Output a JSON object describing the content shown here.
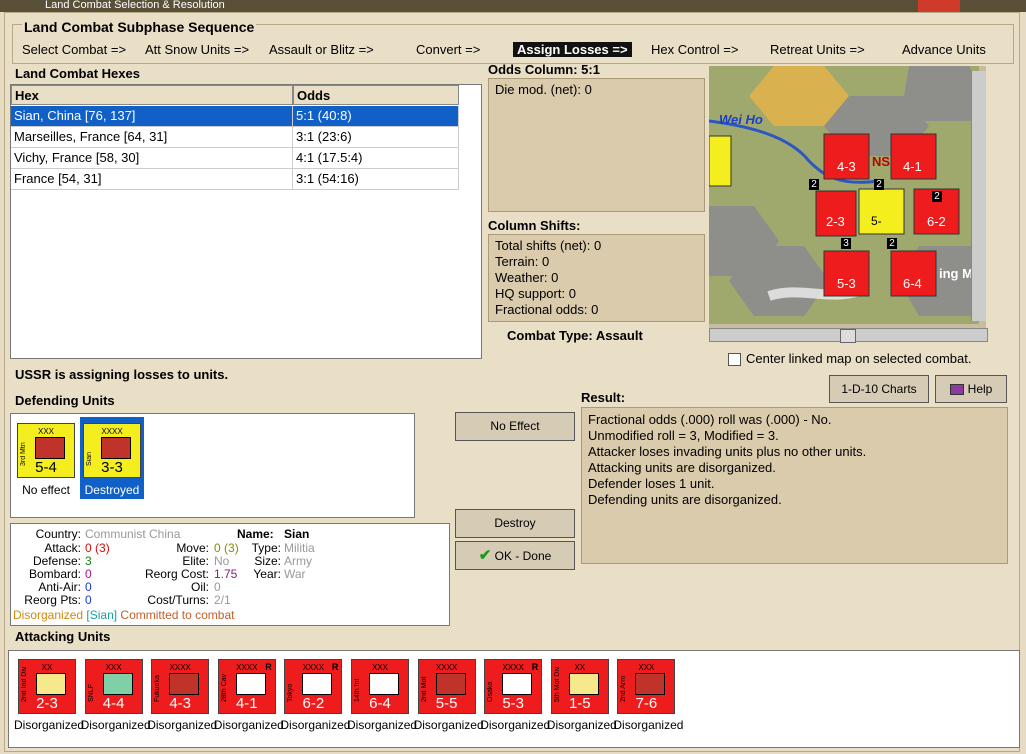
{
  "window": {
    "title": "Land Combat Selection & Resolution"
  },
  "sequence": {
    "title": "Land Combat Subphase Sequence",
    "steps": [
      "Select Combat =>",
      "Att Snow Units =>",
      "Assault or Blitz =>",
      "Convert =>",
      "Assign Losses =>",
      "Hex Control =>",
      "Retreat Units =>",
      "Advance Units"
    ],
    "active_step": "Assign Losses =>"
  },
  "hexes": {
    "title": "Land Combat Hexes",
    "columns": [
      "Hex",
      "Odds"
    ],
    "rows": [
      {
        "hex": "Sian, China [76, 137]",
        "odds": "5:1 (40:8)"
      },
      {
        "hex": "Marseilles, France [64, 31]",
        "odds": "3:1 (23:6)"
      },
      {
        "hex": "Vichy, France [58, 30]",
        "odds": "4:1 (17.5:4)"
      },
      {
        "hex": "France [54, 31]",
        "odds": "3:1 (54:16)"
      }
    ]
  },
  "odds": {
    "title": "Odds Column: 5:1",
    "die_mod": "Die mod. (net): 0"
  },
  "shifts": {
    "title": "Column Shifts:",
    "lines": [
      "Total shifts (net): 0",
      "Terrain: 0",
      "Weather: 0",
      "HQ support: 0",
      "Fractional odds: 0"
    ]
  },
  "combat_type": "Combat Type:  Assault",
  "map": {
    "labels": [
      "Wei Ho",
      "NS",
      "ing Mts"
    ],
    "counters": [
      {
        "name": "2nd Ind Div",
        "val": "2-3"
      },
      {
        "name": "Sian",
        "val": "5-"
      },
      {
        "name": "Fukuoka",
        "val": "4-3"
      },
      {
        "name": "28th Cav",
        "val": "4-1"
      },
      {
        "name": "Tokyo",
        "val": "6-2"
      },
      {
        "name": "Osaka",
        "val": "5-3"
      },
      {
        "name": "14th Inf",
        "val": "6-4"
      }
    ],
    "stack_counts": [
      "2",
      "2",
      "2",
      "3",
      "2"
    ]
  },
  "center_linked": {
    "label": "Center linked map on selected combat.",
    "checked": false
  },
  "buttons": {
    "charts": "1-D-10 Charts",
    "help": "Help",
    "no_effect": "No Effect",
    "destroy": "Destroy",
    "ok_done": "OK - Done"
  },
  "status": "USSR is assigning losses to units.",
  "defending": {
    "title": "Defending Units",
    "units": [
      {
        "name": "3rd Mtn",
        "size": "XXX",
        "val": "5-4",
        "status": "No effect",
        "selected": false
      },
      {
        "name": "Sian",
        "size": "XXXX",
        "val": "3-3",
        "status": "Destroyed",
        "selected": true
      }
    ]
  },
  "result": {
    "title": "Result:",
    "lines": [
      "Fractional odds (.000) roll was (.000)  - No.",
      "Unmodified roll = 3, Modified = 3.",
      "Attacker loses invading units plus no other units.",
      "Attacking units are disorganized.",
      "Defender loses 1 unit.",
      "Defending units are disorganized."
    ]
  },
  "details": {
    "country_k": "Country:",
    "country_v": "Communist China",
    "attack_k": "Attack:",
    "attack_v": "0",
    "attack_v2": "(3)",
    "defense_k": "Defense:",
    "defense_v": "3",
    "bombard_k": "Bombard:",
    "bombard_v": "0",
    "antiair_k": "Anti-Air:",
    "antiair_v": "0",
    "reorg_k": "Reorg Pts:",
    "reorg_v": "0",
    "name_k": "Name:",
    "name_v": "Sian",
    "move_k": "Move:",
    "move_v": "0",
    "move_v2": "(3)",
    "elite_k": "Elite:",
    "elite_v": "No",
    "reorgcost_k": "Reorg Cost:",
    "reorgcost_v": "1.75",
    "oil_k": "Oil:",
    "oil_v": "0",
    "costturns_k": "Cost/Turns:",
    "costturns_v": "2/1",
    "type_k": "Type:",
    "type_v": "Militia",
    "size_k": "Size:",
    "size_v": "Army",
    "year_k": "Year:",
    "year_v": "War",
    "flags": [
      "Disorganized",
      "[Sian]",
      "Committed to combat"
    ]
  },
  "attacking": {
    "title": "Attacking Units",
    "units": [
      {
        "name": "2nd Ind Div",
        "size": "XX",
        "val": "2-3",
        "r": "",
        "color": "#f5e98c",
        "status": "Disorganized"
      },
      {
        "name": "SNLF",
        "size": "XXX",
        "val": "4-4",
        "r": "",
        "color": "#7fd0a6",
        "status": "Disorganized"
      },
      {
        "name": "Fukuoka",
        "size": "XXXX",
        "val": "4-3",
        "r": "",
        "color": "#c0332a",
        "status": "Disorganized"
      },
      {
        "name": "28th Cav",
        "size": "XXXX",
        "val": "4-1",
        "r": "R",
        "color": "#ffffff",
        "status": "Disorganized"
      },
      {
        "name": "Tokyo",
        "size": "XXXX",
        "val": "6-2",
        "r": "R",
        "color": "#ffffff",
        "status": "Disorganized"
      },
      {
        "name": "14th Inf",
        "size": "XXX",
        "val": "6-4",
        "r": "",
        "color": "#ffffff",
        "status": "Disorganized"
      },
      {
        "name": "2nd Mot",
        "size": "XXXX",
        "val": "5-5",
        "r": "",
        "color": "#c0332a",
        "status": "Disorganized"
      },
      {
        "name": "Osaka",
        "size": "XXXX",
        "val": "5-3",
        "r": "R",
        "color": "#ffffff",
        "status": "Disorganized"
      },
      {
        "name": "5th Mot Div",
        "size": "XX",
        "val": "1-5",
        "r": "",
        "color": "#f5e98c",
        "status": "Disorganized"
      },
      {
        "name": "2nd Arm",
        "size": "XXX",
        "val": "7-6",
        "r": "",
        "color": "#c0332a",
        "status": "Disorganized"
      }
    ]
  },
  "colors": {
    "counter_red": "#ee1c1c",
    "counter_yellow": "#f5ee1e",
    "select_blue": "#1160c8"
  }
}
